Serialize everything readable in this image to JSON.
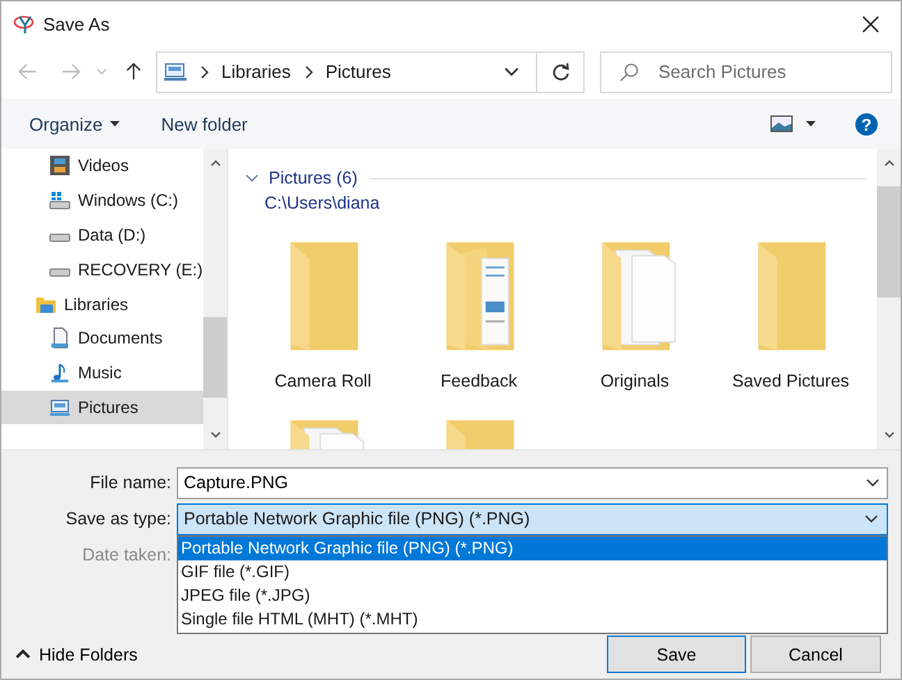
{
  "window": {
    "title": "Save As"
  },
  "address_bar": {
    "crumbs": [
      "Libraries",
      "Pictures"
    ],
    "search_placeholder": "Search Pictures"
  },
  "toolbar": {
    "organize": "Organize",
    "new_folder": "New folder",
    "help": "?"
  },
  "sidebar": {
    "items": [
      {
        "label": "Videos",
        "kind": "video",
        "selected": false
      },
      {
        "label": "Windows (C:)",
        "kind": "drive-windows",
        "selected": false
      },
      {
        "label": "Data (D:)",
        "kind": "drive",
        "selected": false
      },
      {
        "label": "RECOVERY (E:)",
        "kind": "drive",
        "selected": false
      },
      {
        "label": "Libraries",
        "kind": "library",
        "selected": false,
        "children": [
          {
            "label": "Documents",
            "kind": "documents",
            "selected": false
          },
          {
            "label": "Music",
            "kind": "music",
            "selected": false
          },
          {
            "label": "Pictures",
            "kind": "pictures",
            "selected": true
          }
        ]
      }
    ]
  },
  "content": {
    "group": {
      "title": "Pictures (6)",
      "path": "C:\\Users\\diana",
      "expanded": true
    },
    "folders": [
      {
        "label": "Camera Roll",
        "kind": "plain"
      },
      {
        "label": "Feedback",
        "kind": "documents"
      },
      {
        "label": "Originals",
        "kind": "papers"
      },
      {
        "label": "Saved Pictures",
        "kind": "plain"
      },
      {
        "kind": "papers"
      },
      {
        "kind": "plain"
      }
    ]
  },
  "form": {
    "file_name_label": "File name:",
    "file_name": "Capture.PNG",
    "type_label": "Save as type:",
    "type_value": "Portable Network Graphic file (PNG) (*.PNG)",
    "type_open": true,
    "type_options": [
      {
        "label": "Portable Network Graphic file (PNG) (*.PNG)",
        "selected": true
      },
      {
        "label": "GIF file (*.GIF)",
        "selected": false
      },
      {
        "label": "JPEG file (*.JPG)",
        "selected": false
      },
      {
        "label": "Single file HTML (MHT) (*.MHT)",
        "selected": false
      }
    ],
    "date_label": "Date taken:",
    "date_disabled": true
  },
  "footer": {
    "hide_folders": "Hide Folders",
    "save": "Save",
    "cancel": "Cancel"
  }
}
